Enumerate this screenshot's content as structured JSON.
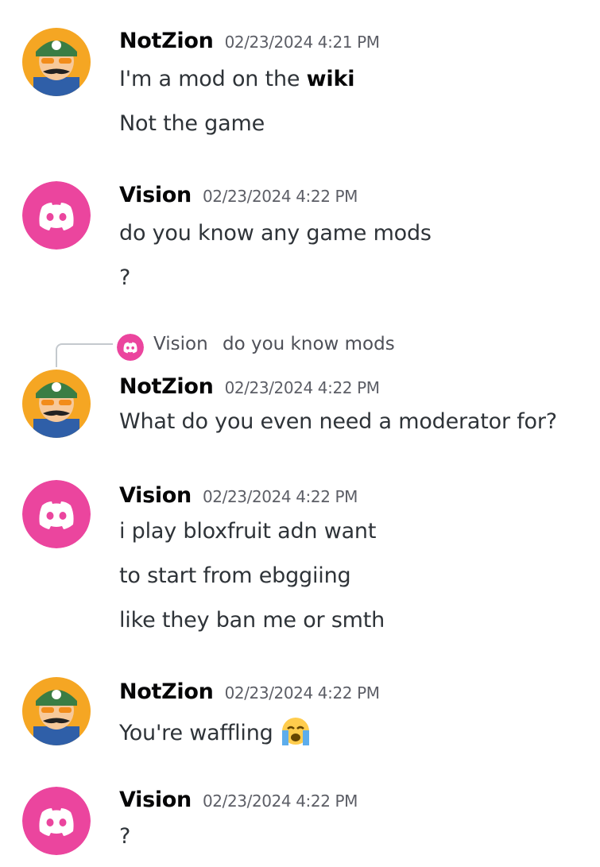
{
  "messages": [
    {
      "author": "NotZion",
      "timestamp": "02/23/2024 4:21 PM",
      "avatar": "luigi-avatar",
      "lines": [
        {
          "text": "I'm a mod on the ",
          "bold": "wiki"
        },
        {
          "text": "Not the game"
        }
      ]
    },
    {
      "author": "Vision",
      "timestamp": "02/23/2024 4:22 PM",
      "avatar": "discord-default-avatar",
      "lines": [
        {
          "text": "do you know any game mods"
        },
        {
          "text": "?"
        }
      ]
    },
    {
      "reply_to": {
        "author": "Vision",
        "text": "do you know mods"
      },
      "author": "NotZion",
      "timestamp": "02/23/2024 4:22 PM",
      "avatar": "luigi-avatar",
      "lines": [
        {
          "text": "What do you even need a moderator for?"
        }
      ]
    },
    {
      "author": "Vision",
      "timestamp": "02/23/2024 4:22 PM",
      "avatar": "discord-default-avatar",
      "lines": [
        {
          "text": "i play bloxfruit adn want"
        },
        {
          "text": "to start from ebggiing"
        },
        {
          "text": "like they ban me or smth"
        }
      ]
    },
    {
      "author": "NotZion",
      "timestamp": "02/23/2024 4:22 PM",
      "avatar": "luigi-avatar",
      "lines": [
        {
          "text": "You're waffling",
          "emoji": "loudly-crying-face-icon"
        }
      ]
    },
    {
      "author": "Vision",
      "timestamp": "02/23/2024 4:22 PM",
      "avatar": "discord-default-avatar",
      "lines": [
        {
          "text": "?"
        }
      ]
    }
  ],
  "colors": {
    "discord_pink": "#eb459e",
    "luigi_bg": "#f5a623",
    "luigi_green": "#3a7d44",
    "text": "#2e3338",
    "timestamp": "#5c5e66"
  }
}
